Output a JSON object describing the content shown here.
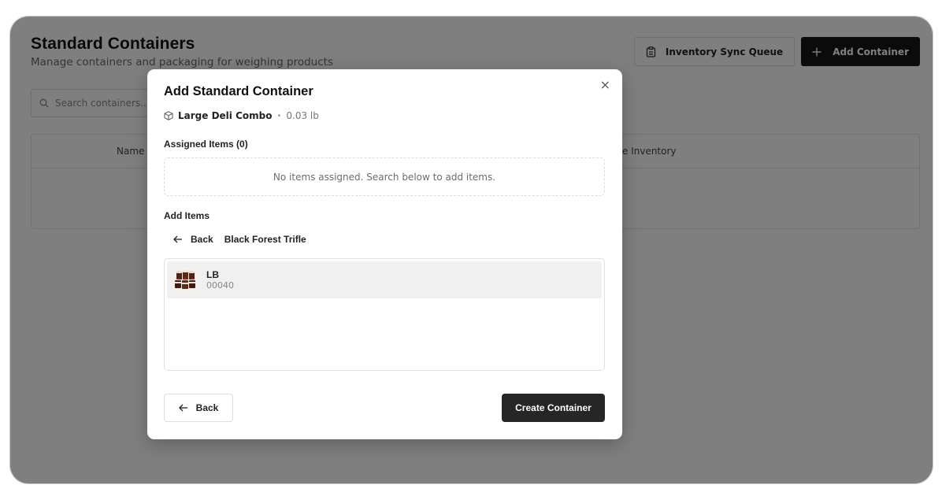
{
  "page": {
    "title": "Standard Containers",
    "subtitle": "Manage containers and packaging for weighing products"
  },
  "header_actions": {
    "sync_queue_label": "Inventory Sync Queue",
    "add_container_label": "Add Container"
  },
  "search": {
    "placeholder": "Search containers..."
  },
  "table": {
    "columns": [
      "Name",
      "e Inventory"
    ]
  },
  "modal": {
    "title": "Add Standard Container",
    "close_glyph": "×",
    "container": {
      "name": "Large Deli Combo",
      "separator": "•",
      "weight": "0.03 lb"
    },
    "assigned_label": "Assigned Items (0)",
    "empty_message": "No items assigned. Search below to add items.",
    "add_items_label": "Add Items",
    "nav": {
      "back_label": "Back",
      "current": "Black Forest Trifle"
    },
    "items": [
      {
        "title": "LB",
        "code": "00040"
      }
    ],
    "footer": {
      "back_label": "Back",
      "create_label": "Create Container"
    }
  },
  "colors": {
    "primary_button": "#262626",
    "overlay": "rgba(0,0,0,0.5)"
  }
}
